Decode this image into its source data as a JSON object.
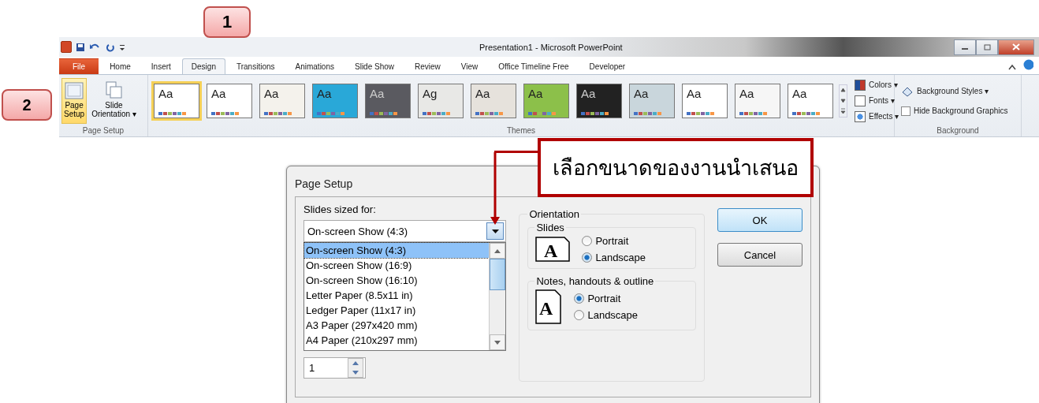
{
  "callouts": [
    {
      "kind": "tag",
      "text": "1"
    },
    {
      "kind": "side",
      "text": "2"
    },
    {
      "kind": "note",
      "text": "เลือกขนาดของงานนำเสนอ"
    }
  ],
  "window": {
    "title": "Presentation1  -  Microsoft PowerPoint"
  },
  "tabs": [
    {
      "label": "File",
      "kind": "file",
      "selected": false
    },
    {
      "label": "Home",
      "kind": "tab",
      "selected": false
    },
    {
      "label": "Insert",
      "kind": "tab",
      "selected": false
    },
    {
      "label": "Design",
      "kind": "tab",
      "selected": true
    },
    {
      "label": "Transitions",
      "kind": "tab",
      "selected": false
    },
    {
      "label": "Animations",
      "kind": "tab",
      "selected": false
    },
    {
      "label": "Slide Show",
      "kind": "tab",
      "selected": false
    },
    {
      "label": "Review",
      "kind": "tab",
      "selected": false
    },
    {
      "label": "View",
      "kind": "tab",
      "selected": false
    },
    {
      "label": "Office Timeline Free",
      "kind": "tab",
      "selected": false
    },
    {
      "label": "Developer",
      "kind": "tab",
      "selected": false
    }
  ],
  "page_setup_group": {
    "label": "Page Setup",
    "buttons": [
      {
        "label": "Page\nSetup",
        "kind": "page",
        "selected": true
      },
      {
        "label": "Slide\nOrientation ▾",
        "kind": "orient",
        "selected": false
      }
    ]
  },
  "themes_group": {
    "label": "Themes",
    "themes": [
      {
        "label": "Aa",
        "color": "#ffffff",
        "selected": true
      },
      {
        "label": "Aa",
        "color": "#ffffff",
        "selected": false
      },
      {
        "label": "Aa",
        "color": "#f4f2ec",
        "selected": false
      },
      {
        "label": "Aa",
        "color": "#29a8d8",
        "selected": false
      },
      {
        "label": "Aa",
        "color": "#5a5a60",
        "selected": false
      },
      {
        "label": "Ag",
        "color": "#e8e8e6",
        "selected": false
      },
      {
        "label": "Aa",
        "color": "#e6e2dc",
        "selected": false
      },
      {
        "label": "Aa",
        "color": "#8cc04a",
        "selected": false
      },
      {
        "label": "Aa",
        "color": "#222222",
        "selected": false
      },
      {
        "label": "Aa",
        "color": "#c9d6dc",
        "selected": false
      },
      {
        "label": "Aa",
        "color": "#ffffff",
        "selected": false
      },
      {
        "label": "Aa",
        "color": "#f6f6f6",
        "selected": false
      },
      {
        "label": "Aa",
        "color": "#ffffff",
        "selected": false
      }
    ],
    "options": [
      "Colors ▾",
      "Fonts ▾",
      "Effects ▾"
    ]
  },
  "background_group": {
    "label": "Background",
    "styles_button": "Background Styles ▾",
    "hide_graphics": {
      "label": "Hide Background Graphics",
      "checked": false
    }
  },
  "dialog": {
    "title": "Page Setup",
    "size_label": "Slides sized for:",
    "size_value": "On-screen Show (4:3)",
    "sizes": [
      {
        "label": "On-screen Show (4:3)",
        "selected": true
      },
      {
        "label": "On-screen Show (16:9)",
        "selected": false
      },
      {
        "label": "On-screen Show (16:10)",
        "selected": false
      },
      {
        "label": "Letter Paper (8.5x11 in)",
        "selected": false
      },
      {
        "label": "Ledger Paper (11x17 in)",
        "selected": false
      },
      {
        "label": "A3 Paper (297x420 mm)",
        "selected": false
      },
      {
        "label": "A4 Paper (210x297 mm)",
        "selected": false
      }
    ],
    "number_value": "1",
    "orientation": {
      "label": "Orientation",
      "groups": [
        {
          "label": "Slides",
          "kind": "landscape",
          "icon_text": "A",
          "options": [
            {
              "label": "Portrait",
              "selected": false
            },
            {
              "label": "Landscape",
              "selected": true
            }
          ]
        },
        {
          "label": "Notes, handouts & outline",
          "kind": "portrait",
          "icon_text": "A",
          "options": [
            {
              "label": "Portrait",
              "selected": true
            },
            {
              "label": "Landscape",
              "selected": false
            }
          ]
        }
      ]
    },
    "buttons": [
      {
        "label": "OK",
        "kind": "default"
      },
      {
        "label": "Cancel",
        "kind": "normal"
      }
    ]
  }
}
